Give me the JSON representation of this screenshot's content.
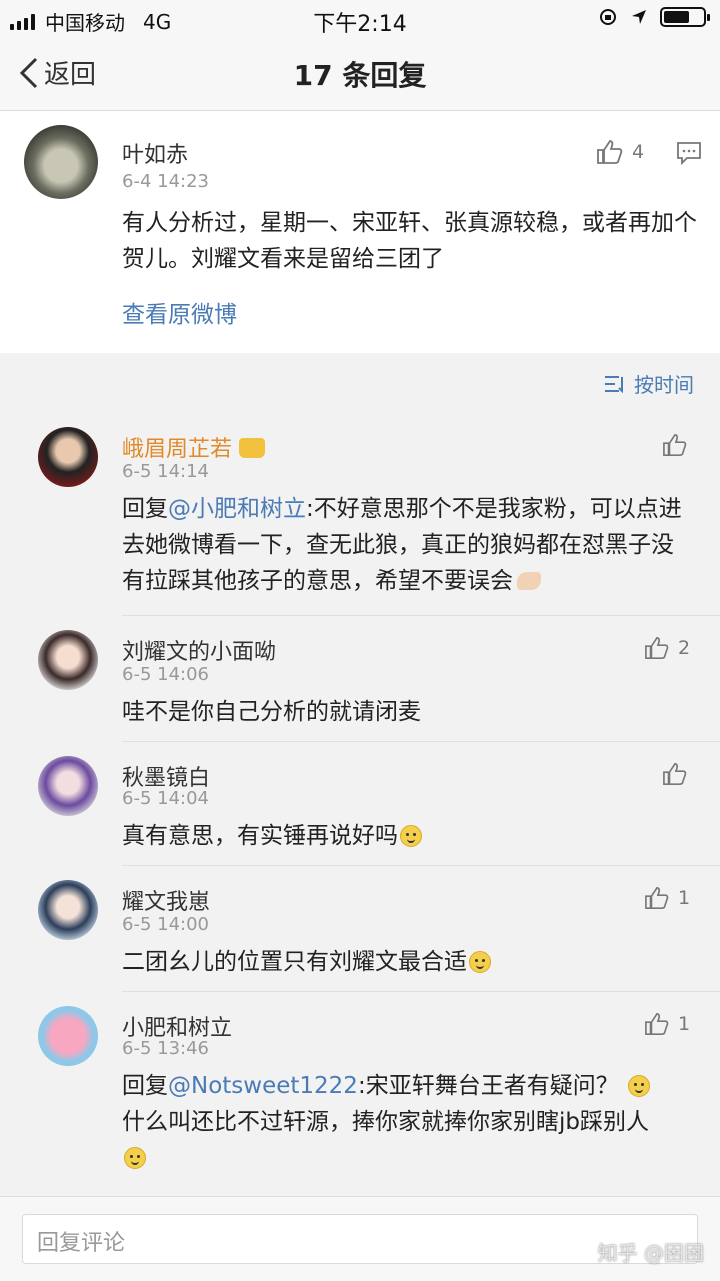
{
  "status": {
    "carrier": "中国移动",
    "network": "4G",
    "time": "下午2:14"
  },
  "nav": {
    "back_label": "返回",
    "title": "17 条回复"
  },
  "main_comment": {
    "user": "叶如赤",
    "time": "6-4 14:23",
    "likes": "4",
    "text": "有人分析过，星期一、宋亚轩、张真源较稳，或者再加个贺儿。刘耀文看来是留给三团了",
    "view_original": "查看原微博"
  },
  "sort": {
    "label": "按时间"
  },
  "replies": [
    {
      "user": "峨眉周芷若",
      "time": "6-5 14:14",
      "likes": "",
      "prefix": "回复",
      "mention": "@小肥和树立",
      "text": ":不好意思那个不是我家粉，可以点进去她微博看一下，查无此狼，真正的狼妈都在怼黑子没有拉踩其他孩子的意思，希望不要误会"
    },
    {
      "user": "刘耀文的小面呦",
      "time": "6-5 14:06",
      "likes": "2",
      "text": "哇不是你自己分析的就请闭麦"
    },
    {
      "user": "秋墨镜白",
      "time": "6-5 14:04",
      "likes": "",
      "text": "真有意思，有实锤再说好吗"
    },
    {
      "user": "耀文我崽",
      "time": "6-5 14:00",
      "likes": "1",
      "text": "二团幺儿的位置只有刘耀文最合适"
    },
    {
      "user": "小肥和树立",
      "time": "6-5 13:46",
      "likes": "1",
      "prefix": "回复",
      "mention": "@Notsweet1222",
      "text": ":宋亚轩舞台王者有疑问？",
      "text2": "什么叫还比不过轩源，捧你家就捧你家别瞎jb踩别人"
    }
  ],
  "input": {
    "placeholder": "回复评论"
  },
  "watermark": "知乎 @困困"
}
